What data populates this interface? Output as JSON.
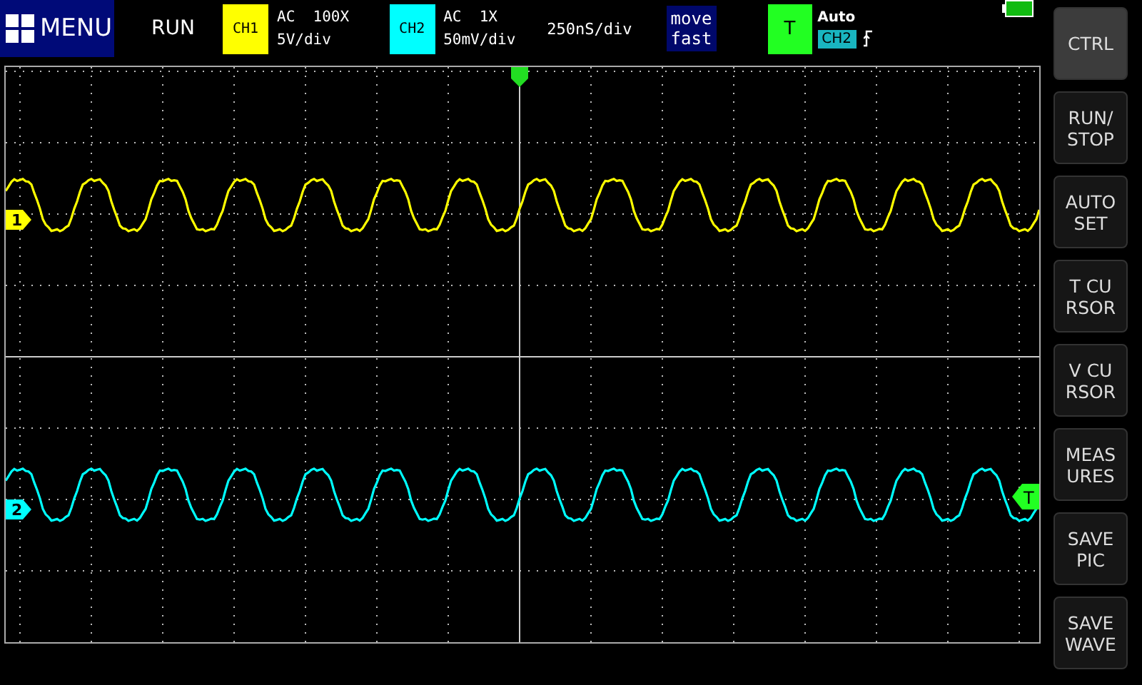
{
  "header": {
    "menu": "MENU",
    "run_state": "RUN",
    "channels": [
      {
        "label": "CH1",
        "color": "#ffff00",
        "coupling": "AC  100X",
        "scale": "5V/div"
      },
      {
        "label": "CH2",
        "color": "#00ffff",
        "coupling": "AC  1X",
        "scale": "50mV/div"
      }
    ],
    "timebase": "250nS/div",
    "move_mode": [
      "move",
      "fast"
    ],
    "trigger": {
      "label": "T",
      "mode": "Auto",
      "source": "CH2"
    }
  },
  "traces": [
    {
      "marker": "1",
      "color": "#ffff00"
    },
    {
      "marker": "2",
      "color": "#00ffff"
    }
  ],
  "trigger_level_marker": "T",
  "side_buttons": [
    {
      "lines": [
        "CTRL"
      ]
    },
    {
      "lines": [
        "RUN/",
        "STOP"
      ]
    },
    {
      "lines": [
        "AUTO",
        "SET"
      ]
    },
    {
      "lines": [
        "T CU",
        "RSOR"
      ]
    },
    {
      "lines": [
        "V CU",
        "RSOR"
      ]
    },
    {
      "lines": [
        "MEAS",
        "URES"
      ]
    },
    {
      "lines": [
        "SAVE",
        "PIC"
      ]
    },
    {
      "lines": [
        "SAVE",
        "WAVE"
      ]
    }
  ]
}
